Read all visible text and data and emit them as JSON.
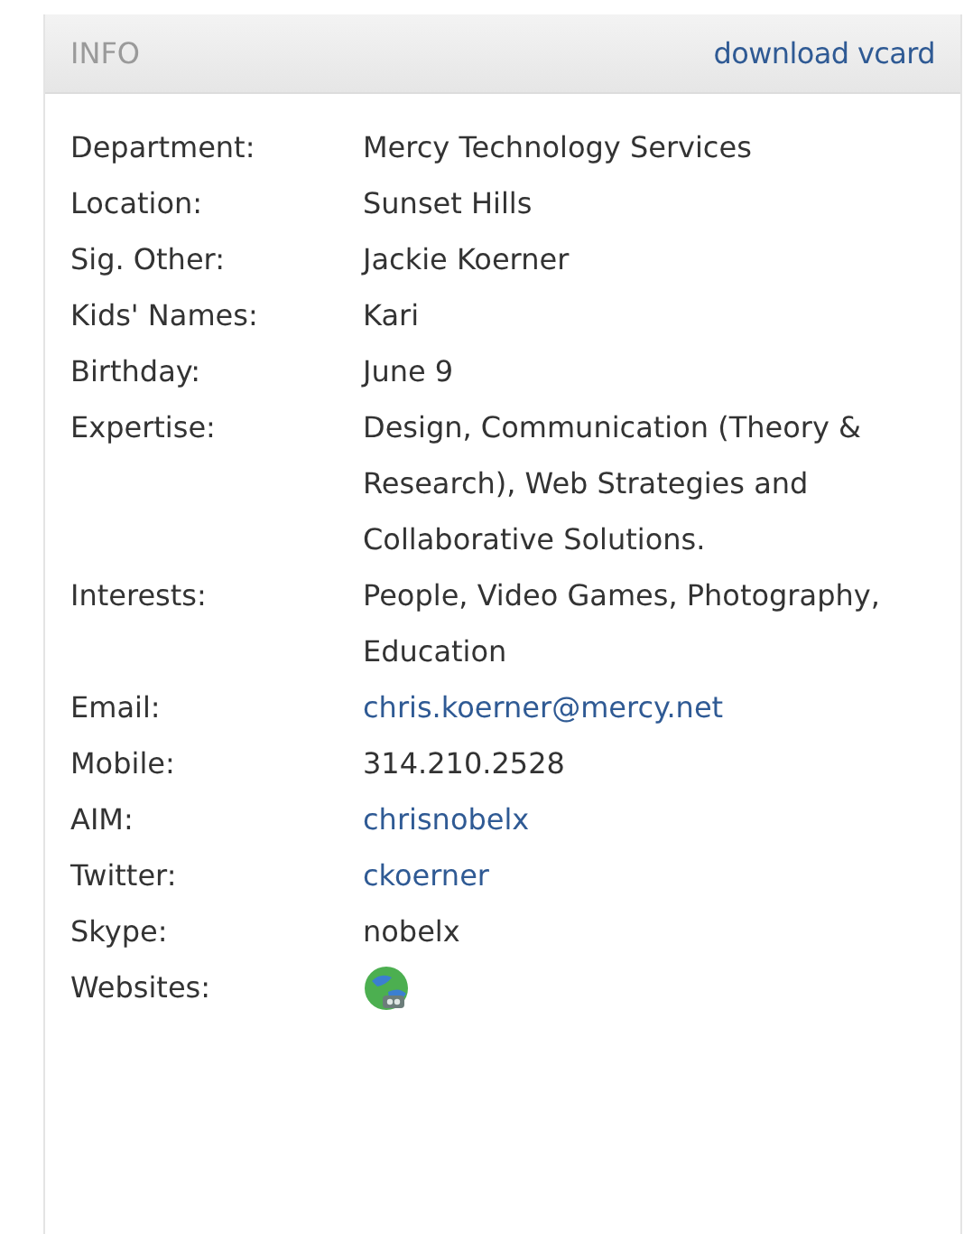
{
  "header": {
    "title": "INFO",
    "action": "download vcard"
  },
  "fields": [
    {
      "label": "Department:",
      "kind": "text",
      "value": "Mercy Technology Services"
    },
    {
      "label": "Location:",
      "kind": "text",
      "value": "Sunset Hills"
    },
    {
      "label": "Sig. Other:",
      "kind": "text",
      "value": "Jackie Koerner"
    },
    {
      "label": "Kids' Names:",
      "kind": "text",
      "value": "Kari"
    },
    {
      "label": "Birthday:",
      "kind": "text",
      "value": "June 9"
    },
    {
      "label": "Expertise:",
      "kind": "text",
      "value": "Design, Communication (Theory & Research), Web Strategies and Collaborative Solutions."
    },
    {
      "label": "Interests:",
      "kind": "text",
      "value": "People, Video Games, Photography, Education"
    },
    {
      "label": "Email:",
      "kind": "link",
      "value": "chris.koerner@mercy.net"
    },
    {
      "label": "Mobile:",
      "kind": "text",
      "value": "314.210.2528"
    },
    {
      "label": "AIM:",
      "kind": "link",
      "value": "chrisnobelx"
    },
    {
      "label": "Twitter:",
      "kind": "link",
      "value": "ckoerner"
    },
    {
      "label": "Skype:",
      "kind": "text",
      "value": "nobelx"
    },
    {
      "label": "Websites:",
      "kind": "icon"
    }
  ]
}
